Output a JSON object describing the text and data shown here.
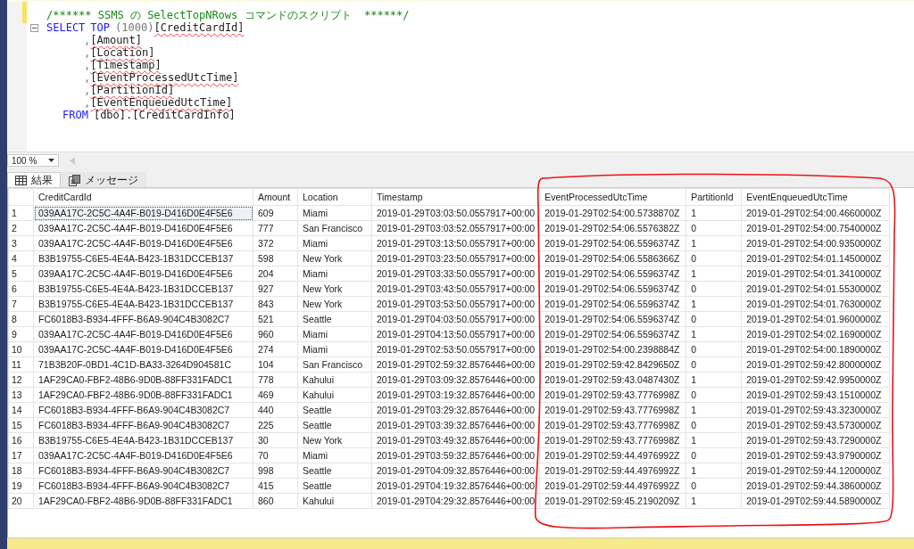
{
  "editor": {
    "lines": [
      {
        "kind": "comment",
        "expanded": false,
        "tokens": [
          {
            "kind": "comment",
            "text": "/****** SSMS の SelectTopNRows コマンドのスクリプト  ******/"
          }
        ]
      },
      {
        "kind": "first",
        "expanded": true,
        "tokens": [
          {
            "kind": "keyword",
            "text": "SELECT"
          },
          {
            "kind": "keyword",
            "text": "TOP"
          },
          {
            "kind": "operator",
            "text": "(1000)"
          },
          {
            "kind": "identifier",
            "text": "[CreditCardId]"
          }
        ]
      },
      {
        "kind": "continuation",
        "expanded": false,
        "tokens": [
          {
            "kind": "operator",
            "text": ","
          },
          {
            "kind": "identifier",
            "text": "[Amount]"
          }
        ]
      },
      {
        "kind": "continuation",
        "expanded": false,
        "tokens": [
          {
            "kind": "operator",
            "text": ","
          },
          {
            "kind": "identifier",
            "text": "[Location]"
          }
        ]
      },
      {
        "kind": "continuation",
        "expanded": false,
        "tokens": [
          {
            "kind": "operator",
            "text": ","
          },
          {
            "kind": "identifier",
            "text": "[Timestamp]"
          }
        ]
      },
      {
        "kind": "continuation",
        "expanded": false,
        "tokens": [
          {
            "kind": "operator",
            "text": ","
          },
          {
            "kind": "identifier",
            "text": "[EventProcessedUtcTime]"
          }
        ]
      },
      {
        "kind": "continuation",
        "expanded": false,
        "tokens": [
          {
            "kind": "operator",
            "text": ","
          },
          {
            "kind": "identifier",
            "text": "[PartitionId]"
          }
        ]
      },
      {
        "kind": "continuation",
        "expanded": false,
        "tokens": [
          {
            "kind": "operator",
            "text": ","
          },
          {
            "kind": "identifier",
            "text": "[EventEnqueuedUtcTime]"
          }
        ]
      },
      {
        "kind": "from",
        "expanded": false,
        "tokens": [
          {
            "kind": "keyword",
            "text": "FROM"
          },
          {
            "kind": "plain",
            "text": "[dbo].[CreditCardInfo]"
          }
        ]
      }
    ]
  },
  "zoom": {
    "value": "100 %"
  },
  "tabs": [
    {
      "label": "結果",
      "kind": "grid",
      "selected": true
    },
    {
      "label": "メッセージ",
      "kind": "messages",
      "selected": false
    }
  ],
  "table": {
    "columns": [
      "CreditCardId",
      "Amount",
      "Location",
      "Timestamp",
      "EventProcessedUtcTime",
      "PartitionId",
      "EventEnqueuedUtcTime"
    ],
    "rows": [
      {
        "num": "1",
        "selected": true,
        "cells": [
          "039AA17C-2C5C-4A4F-B019-D416D0E4F5E6",
          "609",
          "Miami",
          "2019-01-29T03:03:50.0557917+00:00",
          "2019-01-29T02:54:00.5738870Z",
          "1",
          "2019-01-29T02:54:00.4660000Z"
        ]
      },
      {
        "num": "2",
        "selected": false,
        "cells": [
          "039AA17C-2C5C-4A4F-B019-D416D0E4F5E6",
          "777",
          "San Francisco",
          "2019-01-29T03:03:52.0557917+00:00",
          "2019-01-29T02:54:06.5576382Z",
          "0",
          "2019-01-29T02:54:00.7540000Z"
        ]
      },
      {
        "num": "3",
        "selected": false,
        "cells": [
          "039AA17C-2C5C-4A4F-B019-D416D0E4F5E6",
          "372",
          "Miami",
          "2019-01-29T03:13:50.0557917+00:00",
          "2019-01-29T02:54:06.5596374Z",
          "1",
          "2019-01-29T02:54:00.9350000Z"
        ]
      },
      {
        "num": "4",
        "selected": false,
        "cells": [
          "B3B19755-C6E5-4E4A-B423-1B31DCCEB137",
          "598",
          "New York",
          "2019-01-29T03:23:50.0557917+00:00",
          "2019-01-29T02:54:06.5586366Z",
          "0",
          "2019-01-29T02:54:01.1450000Z"
        ]
      },
      {
        "num": "5",
        "selected": false,
        "cells": [
          "039AA17C-2C5C-4A4F-B019-D416D0E4F5E6",
          "204",
          "Miami",
          "2019-01-29T03:33:50.0557917+00:00",
          "2019-01-29T02:54:06.5596374Z",
          "1",
          "2019-01-29T02:54:01.3410000Z"
        ]
      },
      {
        "num": "6",
        "selected": false,
        "cells": [
          "B3B19755-C6E5-4E4A-B423-1B31DCCEB137",
          "927",
          "New York",
          "2019-01-29T03:43:50.0557917+00:00",
          "2019-01-29T02:54:06.5596374Z",
          "0",
          "2019-01-29T02:54:01.5530000Z"
        ]
      },
      {
        "num": "7",
        "selected": false,
        "cells": [
          "B3B19755-C6E5-4E4A-B423-1B31DCCEB137",
          "843",
          "New York",
          "2019-01-29T03:53:50.0557917+00:00",
          "2019-01-29T02:54:06.5596374Z",
          "1",
          "2019-01-29T02:54:01.7630000Z"
        ]
      },
      {
        "num": "8",
        "selected": false,
        "cells": [
          "FC6018B3-B934-4FFF-B6A9-904C4B3082C7",
          "521",
          "Seattle",
          "2019-01-29T04:03:50.0557917+00:00",
          "2019-01-29T02:54:06.5596374Z",
          "0",
          "2019-01-29T02:54:01.9600000Z"
        ]
      },
      {
        "num": "9",
        "selected": false,
        "cells": [
          "039AA17C-2C5C-4A4F-B019-D416D0E4F5E6",
          "960",
          "Miami",
          "2019-01-29T04:13:50.0557917+00:00",
          "2019-01-29T02:54:06.5596374Z",
          "1",
          "2019-01-29T02:54:02.1690000Z"
        ]
      },
      {
        "num": "10",
        "selected": false,
        "cells": [
          "039AA17C-2C5C-4A4F-B019-D416D0E4F5E6",
          "274",
          "Miami",
          "2019-01-29T02:53:50.0557917+00:00",
          "2019-01-29T02:54:00.2398884Z",
          "0",
          "2019-01-29T02:54:00.1890000Z"
        ]
      },
      {
        "num": "11",
        "selected": false,
        "cells": [
          "71B3B20F-0BD1-4C1D-BA33-3264D904581C",
          "104",
          "San Francisco",
          "2019-01-29T02:59:32.8576446+00:00",
          "2019-01-29T02:59:42.8429650Z",
          "0",
          "2019-01-29T02:59:42.8000000Z"
        ]
      },
      {
        "num": "12",
        "selected": false,
        "cells": [
          "1AF29CA0-FBF2-48B6-9D0B-88FF331FADC1",
          "778",
          "Kahului",
          "2019-01-29T03:09:32.8576446+00:00",
          "2019-01-29T02:59:43.0487430Z",
          "1",
          "2019-01-29T02:59:42.9950000Z"
        ]
      },
      {
        "num": "13",
        "selected": false,
        "cells": [
          "1AF29CA0-FBF2-48B6-9D0B-88FF331FADC1",
          "469",
          "Kahului",
          "2019-01-29T03:19:32.8576446+00:00",
          "2019-01-29T02:59:43.7776998Z",
          "0",
          "2019-01-29T02:59:43.1510000Z"
        ]
      },
      {
        "num": "14",
        "selected": false,
        "cells": [
          "FC6018B3-B934-4FFF-B6A9-904C4B3082C7",
          "440",
          "Seattle",
          "2019-01-29T03:29:32.8576446+00:00",
          "2019-01-29T02:59:43.7776998Z",
          "1",
          "2019-01-29T02:59:43.3230000Z"
        ]
      },
      {
        "num": "15",
        "selected": false,
        "cells": [
          "FC6018B3-B934-4FFF-B6A9-904C4B3082C7",
          "225",
          "Seattle",
          "2019-01-29T03:39:32.8576446+00:00",
          "2019-01-29T02:59:43.7776998Z",
          "0",
          "2019-01-29T02:59:43.5730000Z"
        ]
      },
      {
        "num": "16",
        "selected": false,
        "cells": [
          "B3B19755-C6E5-4E4A-B423-1B31DCCEB137",
          "30",
          "New York",
          "2019-01-29T03:49:32.8576446+00:00",
          "2019-01-29T02:59:43.7776998Z",
          "1",
          "2019-01-29T02:59:43.7290000Z"
        ]
      },
      {
        "num": "17",
        "selected": false,
        "cells": [
          "039AA17C-2C5C-4A4F-B019-D416D0E4F5E6",
          "70",
          "Miami",
          "2019-01-29T03:59:32.8576446+00:00",
          "2019-01-29T02:59:44.4976992Z",
          "0",
          "2019-01-29T02:59:43.9790000Z"
        ]
      },
      {
        "num": "18",
        "selected": false,
        "cells": [
          "FC6018B3-B934-4FFF-B6A9-904C4B3082C7",
          "998",
          "Seattle",
          "2019-01-29T04:09:32.8576446+00:00",
          "2019-01-29T02:59:44.4976992Z",
          "1",
          "2019-01-29T02:59:44.1200000Z"
        ]
      },
      {
        "num": "19",
        "selected": false,
        "cells": [
          "FC6018B3-B934-4FFF-B6A9-904C4B3082C7",
          "415",
          "Seattle",
          "2019-01-29T04:19:32.8576446+00:00",
          "2019-01-29T02:59:44.4976992Z",
          "0",
          "2019-01-29T02:59:44.3860000Z"
        ]
      },
      {
        "num": "20",
        "selected": false,
        "cells": [
          "1AF29CA0-FBF2-48B6-9D0B-88FF331FADC1",
          "860",
          "Kahului",
          "2019-01-29T04:29:32.8576446+00:00",
          "2019-01-29T02:59:45.2190209Z",
          "1",
          "2019-01-29T02:59:44.5890000Z"
        ]
      }
    ]
  }
}
